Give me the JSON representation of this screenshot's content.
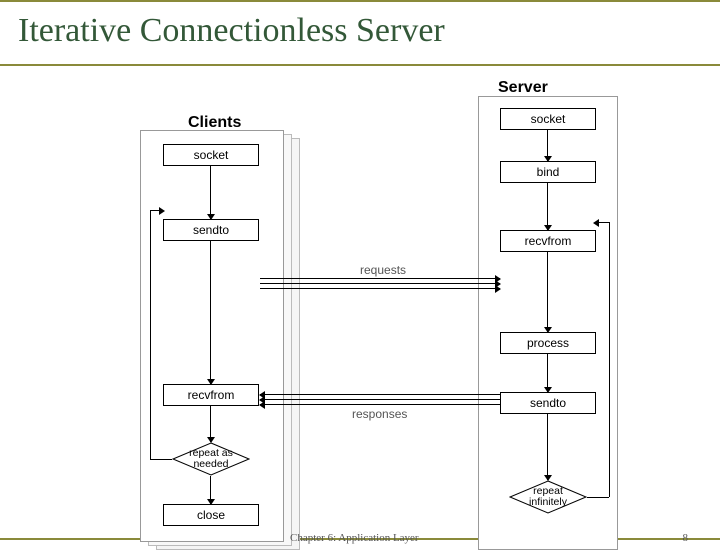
{
  "title": "Iterative Connectionless Server",
  "headers": {
    "clients": "Clients",
    "server": "Server"
  },
  "client": {
    "socket": "socket",
    "sendto": "sendto",
    "recvfrom": "recvfrom",
    "diamond_l1": "repeat as",
    "diamond_l2": "needed",
    "close": "close"
  },
  "server": {
    "socket": "socket",
    "bind": "bind",
    "recvfrom": "recvfrom",
    "process": "process",
    "sendto": "sendto",
    "diamond_l1": "repeat",
    "diamond_l2": "infinitely"
  },
  "labels": {
    "requests": "requests",
    "responses": "responses"
  },
  "footer": {
    "chapter": "Chapter 6: Application Layer",
    "page": "8"
  },
  "chart_data": {
    "type": "flow-diagram",
    "columns": [
      {
        "name": "Clients",
        "stacked_instances": 3,
        "steps": [
          "socket",
          "sendto",
          "recvfrom",
          "repeat as needed",
          "close"
        ],
        "loop": {
          "from": "repeat as needed",
          "to": "sendto"
        }
      },
      {
        "name": "Server",
        "stacked_instances": 1,
        "steps": [
          "socket",
          "bind",
          "recvfrom",
          "process",
          "sendto",
          "repeat infinitely"
        ],
        "loop": {
          "from": "repeat infinitely",
          "to": "recvfrom"
        }
      }
    ],
    "messages": [
      {
        "label": "requests",
        "from": "Clients.sendto",
        "to": "Server.recvfrom",
        "count": 3
      },
      {
        "label": "responses",
        "from": "Server.sendto",
        "to": "Clients.recvfrom",
        "count": 3
      }
    ]
  }
}
